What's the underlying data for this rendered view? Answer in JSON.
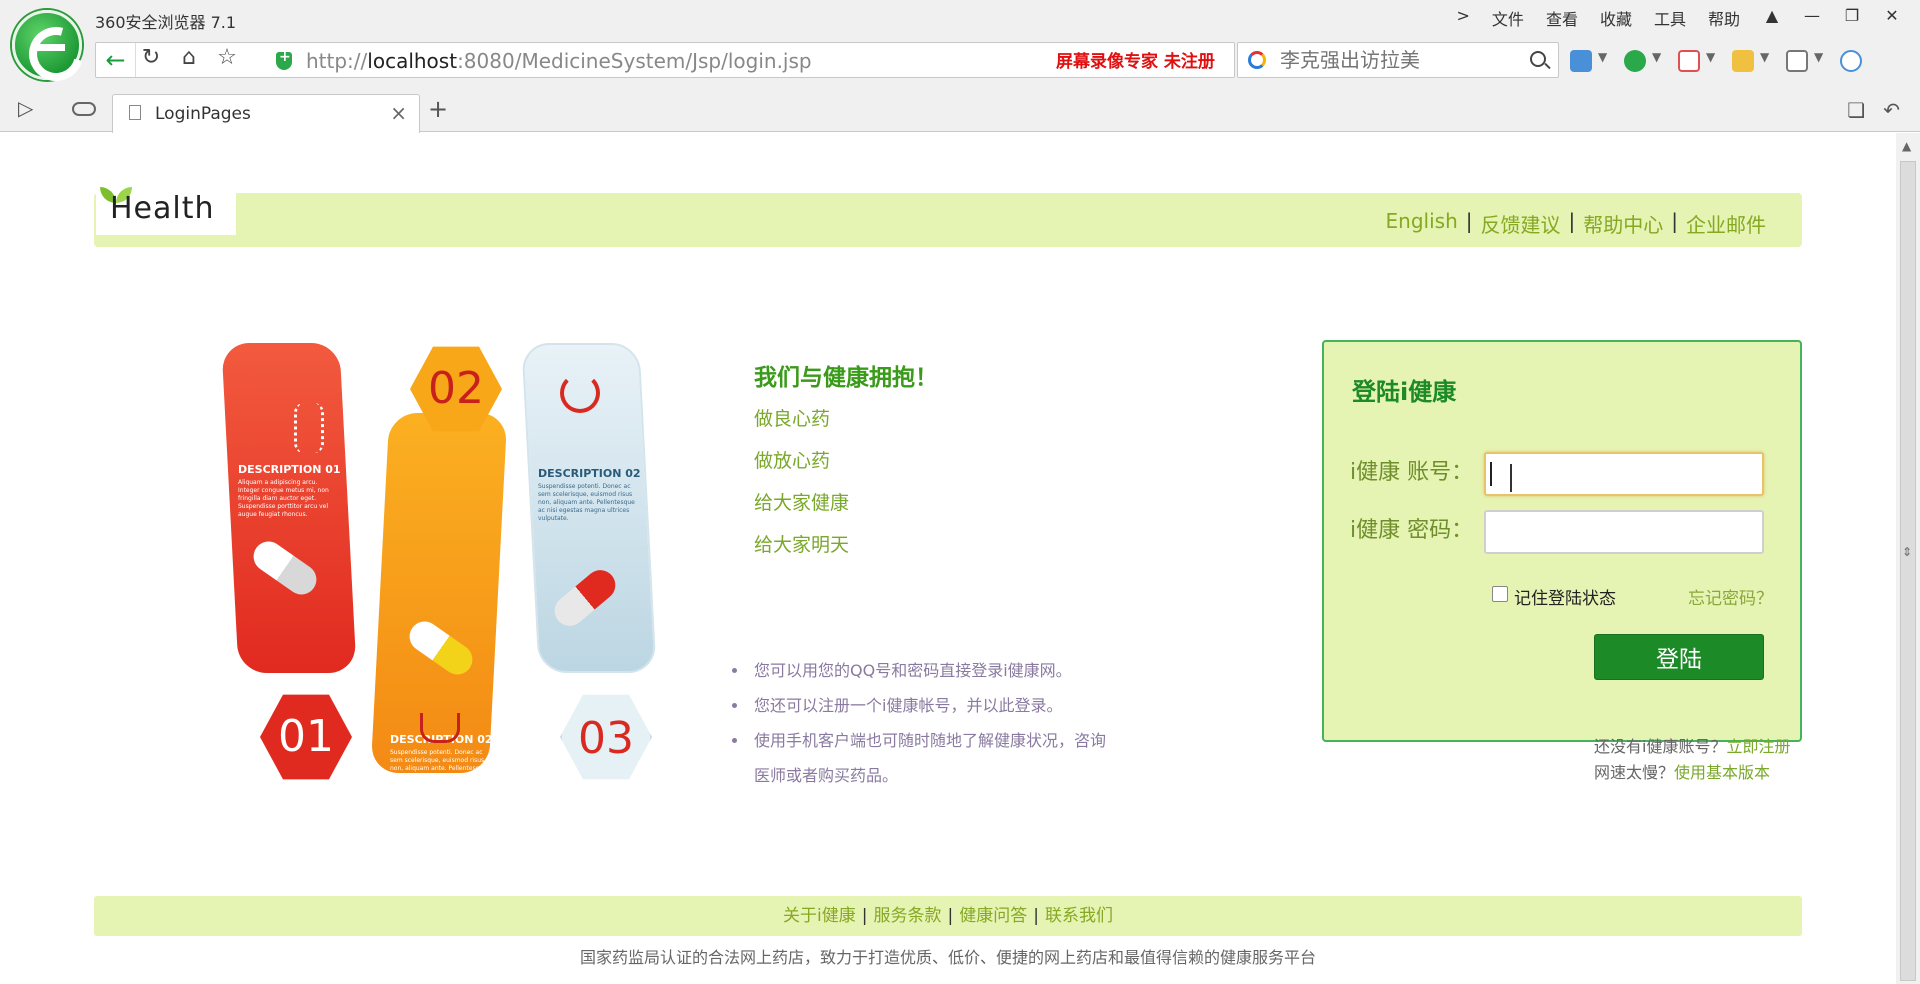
{
  "browser": {
    "app_title": "360安全浏览器 7.1",
    "menu": [
      "文件",
      "查看",
      "收藏",
      "工具",
      "帮助"
    ],
    "menu_chevron": ">",
    "url_host": "localhost",
    "url_prefix": "http://",
    "url_suffix": ":8080/MedicineSystem/Jsp/login.jsp",
    "recording_note": "屏幕录像专家  未注册",
    "search_placeholder": "李克强出访拉美",
    "tab_title": "LoginPages"
  },
  "header": {
    "logo_text": "Health",
    "links": [
      "English",
      "反馈建议",
      "帮助中心",
      "企业邮件"
    ]
  },
  "infographic": {
    "desc1_title": "DESCRIPTION 01",
    "desc1_body": "Aliquam a adipiscing arcu. Integer congue metus mi, non fringilla diam auctor eget. Suspendisse porttitor arcu vel augue feugiat rhoncus.",
    "desc2_title": "DESCRIPTION 02",
    "desc2_body": "Suspendisse potenti. Donec ac sem scelerisque, euismod risus non, aliquam ante. Pellentesque ac nisi egestas magna ultrices vulputate.",
    "desc3_title": "DESCRIPTION 02",
    "desc3_body": "Suspendisse potenti. Donec ac sem scelerisque, euismod risus non, aliquam ante. Pellentesque ac nisi egestas magna ultrices vulputate.",
    "num1": "01",
    "num2": "02",
    "num3": "03"
  },
  "intro": {
    "heading": "我们与健康拥抱！",
    "items": [
      "做良心药",
      "做放心药",
      "给大家健康",
      "给大家明天"
    ],
    "bullets": [
      "您可以用您的QQ号和密码直接登录i健康网。",
      "您还可以注册一个i健康帐号，并以此登录。",
      "使用手机客户端也可随时随地了解健康状况，咨询医师或者购买药品。"
    ]
  },
  "login": {
    "title": "登陆i健康",
    "account_label": "i健康 账号：",
    "password_label": "i健康 密码：",
    "account_value": "",
    "password_value": "",
    "remember_label": "记住登陆状态",
    "forgot_label": "忘记密码？",
    "submit_label": "登陆",
    "register_prefix": "还没有i健康账号？",
    "register_link": "立即注册",
    "basic_prefix": "网速太慢？",
    "basic_link": "使用基本版本"
  },
  "footer": {
    "links": [
      "关于i健康",
      "服务条款",
      "健康问答",
      "联系我们"
    ],
    "note": "国家药监局认证的合法网上药店，致力于打造优质、低价、便捷的网上药店和最值得信赖的健康服务平台"
  }
}
